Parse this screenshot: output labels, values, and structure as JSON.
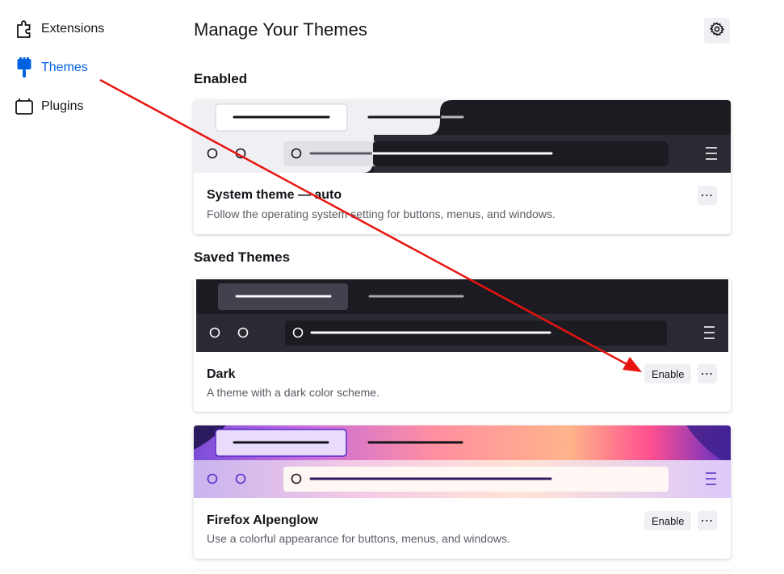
{
  "sidebar": {
    "items": [
      {
        "label": "Extensions",
        "icon": "puzzle-icon"
      },
      {
        "label": "Themes",
        "icon": "paintbrush-icon",
        "active": true
      },
      {
        "label": "Plugins",
        "icon": "plugin-icon"
      }
    ]
  },
  "main": {
    "title": "Manage Your Themes",
    "enabled_heading": "Enabled",
    "saved_heading": "Saved Themes",
    "themes": [
      {
        "name": "System theme — auto",
        "description": "Follow the operating system setting for buttons, menus, and windows.",
        "enabled": true
      },
      {
        "name": "Dark",
        "description": "A theme with a dark color scheme.",
        "enable_label": "Enable"
      },
      {
        "name": "Firefox Alpenglow",
        "description": "Use a colorful appearance for buttons, menus, and windows.",
        "enable_label": "Enable"
      }
    ]
  },
  "colors": {
    "accent": "#0061e0",
    "annotation_arrow": "#e8140f",
    "dark_theme_bg": "#1c1b22",
    "dark_theme_toolbar": "#2b2a33"
  }
}
